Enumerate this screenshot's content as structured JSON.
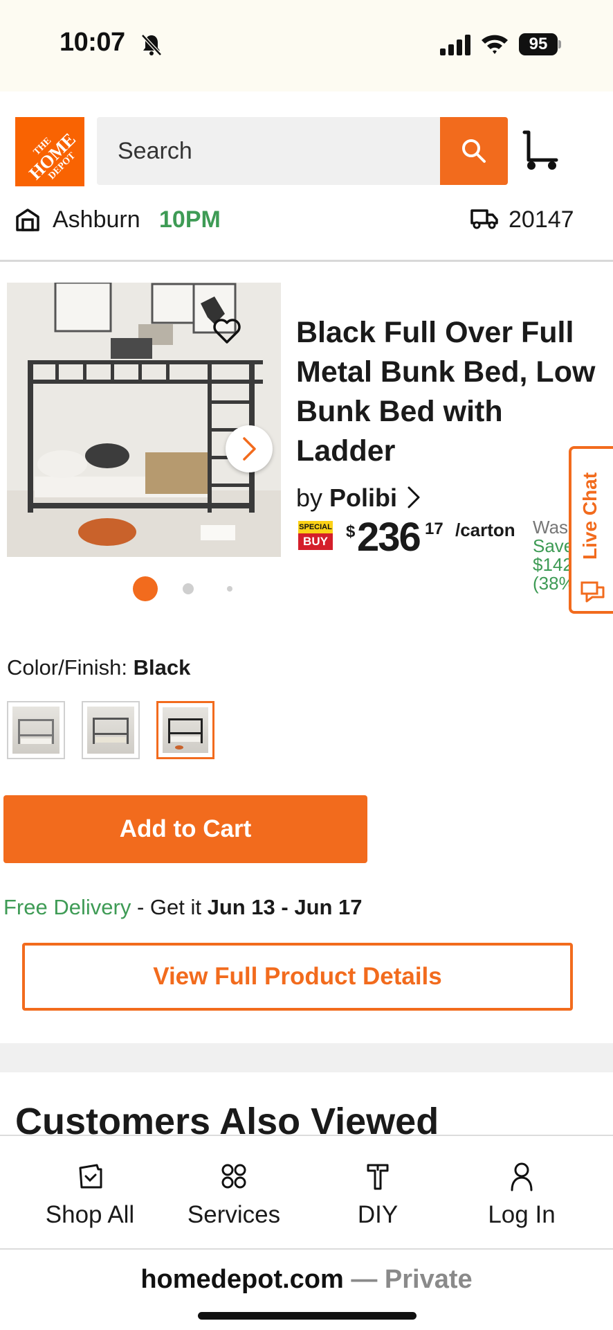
{
  "status_bar": {
    "time": "10:07",
    "battery": "95"
  },
  "header": {
    "logo_lines": [
      "THE",
      "HOME",
      "DEPOT"
    ],
    "search_placeholder": "Search",
    "store_name": "Ashburn",
    "store_hours": "10PM",
    "zip_code": "20147"
  },
  "product": {
    "title": "Black Full Over Full Metal Bunk Bed, Low Bunk Bed with Ladder",
    "by_label": "by",
    "brand": "Polibi",
    "special_buy_top": "SPECIAL",
    "special_buy_bottom": "BUY",
    "price_symbol": "$",
    "price_dollars": "236",
    "price_cents": "17",
    "price_unit": "/carton",
    "was_label": "Was",
    "save_label": "Save",
    "save_amount": "$142",
    "save_percent": "(38%",
    "image_count": 3,
    "active_image_index": 0,
    "color_label": "Color/Finish:",
    "color_value": "Black",
    "selected_swatch_index": 2,
    "add_to_cart_label": "Add to Cart",
    "delivery_free": "Free Delivery",
    "delivery_mid": " - Get it ",
    "delivery_dates": "Jun 13 - Jun 17",
    "view_details_label": "View Full Product Details"
  },
  "live_chat": {
    "label": "Live Chat"
  },
  "sections": {
    "also_viewed_title": "Customers Also Viewed"
  },
  "bottom_nav": {
    "items": [
      {
        "label": "Shop All",
        "icon": "shop-all-icon"
      },
      {
        "label": "Services",
        "icon": "services-icon"
      },
      {
        "label": "DIY",
        "icon": "diy-icon"
      },
      {
        "label": "Log In",
        "icon": "user-icon"
      }
    ]
  },
  "browser": {
    "domain": "homedepot.com",
    "mode": " — Private"
  },
  "colors": {
    "brand_orange": "#f26b1d",
    "green": "#3e9b55"
  }
}
